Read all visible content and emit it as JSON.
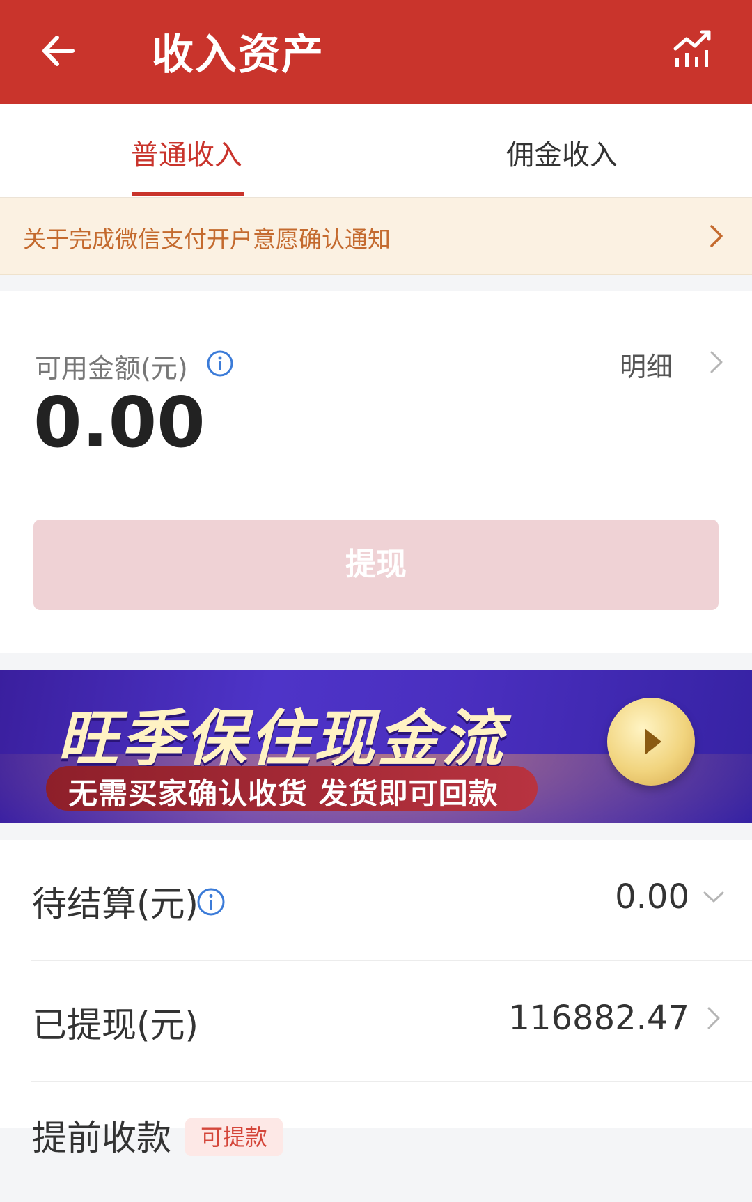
{
  "header": {
    "title": "收入资产",
    "back_icon": "back-arrow-icon",
    "chart_icon": "chart-icon"
  },
  "tabs": [
    {
      "label": "普通收入",
      "active": true
    },
    {
      "label": "佣金收入",
      "active": false
    }
  ],
  "notice": {
    "text": "关于完成微信支付开户意愿确认通知"
  },
  "balance": {
    "label": "可用金额(元)",
    "value": "0.00",
    "detail_label": "明细",
    "withdraw_label": "提现"
  },
  "banner": {
    "title": "旺季保住现金流",
    "subtitle": "无需买家确认收货 发货即可回款"
  },
  "list": [
    {
      "label": "待结算(元)",
      "value": "0.00"
    },
    {
      "label": "已提现(元)",
      "value": "116882.47"
    },
    {
      "label": "提前收款",
      "tag": "可提款"
    }
  ],
  "colors": {
    "header": "#c9342c",
    "accent": "#c9342c",
    "notice_bg": "#fbf1e2",
    "notice_text": "#c46a2e",
    "withdraw_disabled": "#efd2d5"
  }
}
